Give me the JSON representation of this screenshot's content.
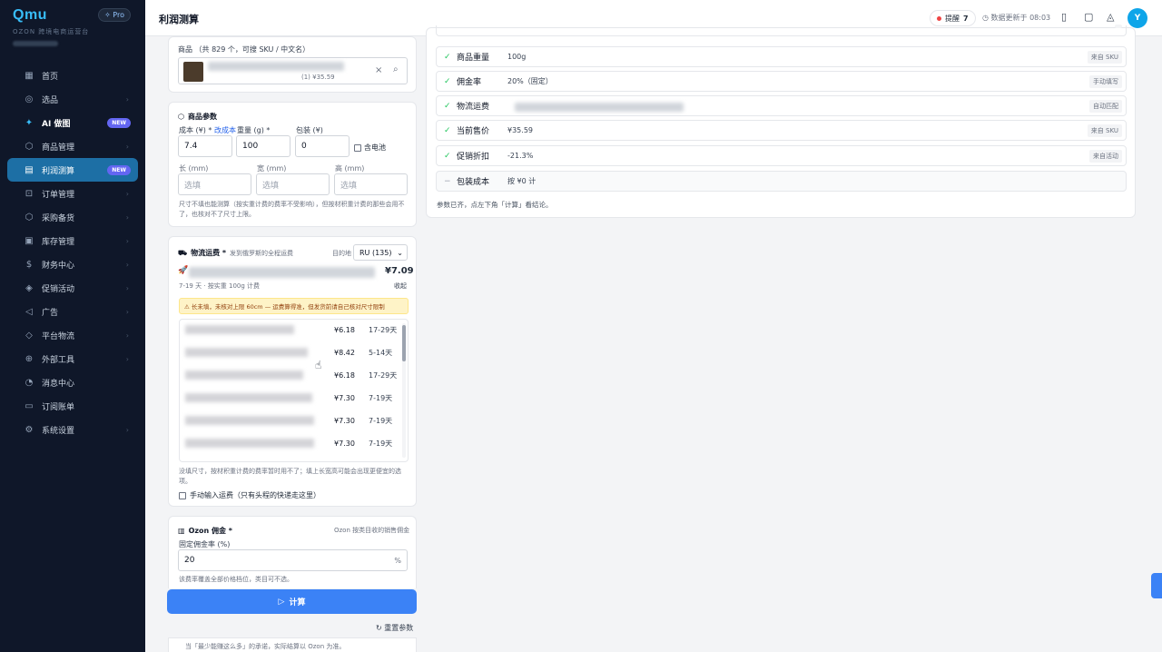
{
  "sidebar": {
    "logo": "Qmu",
    "logo_sub": "OZON 跨境电商运营台",
    "pro": "✧ Pro",
    "new_badge": "NEW",
    "items": [
      {
        "label": "首页",
        "icon": "▦"
      },
      {
        "label": "选品",
        "icon": "◎"
      },
      {
        "label": "AI 做图",
        "icon": "✦"
      },
      {
        "label": "商品管理",
        "icon": "⬡"
      },
      {
        "label": "利润测算",
        "icon": "▤"
      },
      {
        "label": "订单管理",
        "icon": "⊡"
      },
      {
        "label": "采购备货",
        "icon": "⬡"
      },
      {
        "label": "库存管理",
        "icon": "▣"
      },
      {
        "label": "财务中心",
        "icon": "$"
      },
      {
        "label": "促销活动",
        "icon": "◈"
      },
      {
        "label": "广告",
        "icon": "◁"
      },
      {
        "label": "平台物流",
        "icon": "◇"
      },
      {
        "label": "外部工具",
        "icon": "⊕"
      },
      {
        "label": "消息中心",
        "icon": "◔"
      },
      {
        "label": "订阅账单",
        "icon": "▭"
      },
      {
        "label": "系统设置",
        "icon": "⚙"
      }
    ]
  },
  "header": {
    "title": "利润测算",
    "remind_label": "提醒",
    "remind_count": "7",
    "updated": "数据更新于 08:03",
    "avatar": "Y"
  },
  "product": {
    "label": "商品 （共 829 个，可搜 SKU / 中文名）",
    "price_text": "(1) ¥35.59"
  },
  "params": {
    "title": "商品参数",
    "cost_label": "成本 (¥) *",
    "cost_link": "改成本",
    "weight_label": "重量 (g) *",
    "pack_label": "包装 (¥)",
    "cost": "7.4",
    "weight": "100",
    "pack": "0",
    "battery": "含电池",
    "len_label": "长 (mm)",
    "wid_label": "宽 (mm)",
    "hei_label": "高 (mm)",
    "placeholder": "选填",
    "note": "尺寸不填也能测算（按实重计费的费率不受影响），但按材积重计费的那些会用不了，也核对不了尺寸上限。"
  },
  "logistics": {
    "title": "物流运费 *",
    "subtitle": "发到俄罗斯的全程运费",
    "dest_label": "目的地",
    "dest": "RU (135)",
    "selected_price": "¥7.09",
    "selected_meta": "7-19 天 · 按实重 100g 计费",
    "collapse": "收起",
    "warning": "⚠ 长未填，未核对上限 60cm — 运费算得准，但发货前请自己核对尺寸限制",
    "routes": [
      {
        "price": "¥6.18",
        "days": "17-29天"
      },
      {
        "price": "¥8.42",
        "days": "5-14天"
      },
      {
        "price": "¥6.18",
        "days": "17-29天"
      },
      {
        "price": "¥7.30",
        "days": "7-19天"
      },
      {
        "price": "¥7.30",
        "days": "7-19天"
      },
      {
        "price": "¥7.30",
        "days": "7-19天"
      }
    ],
    "note": "没填尺寸，按材积重计费的费率暂时用不了；填上长宽高可能会出现更便宜的选项。",
    "manual": "手动输入运费（只有头程的快递走这里）"
  },
  "commission": {
    "title": "Ozon 佣金 *",
    "hint": "Ozon 按类目收的销售佣金",
    "rate_label": "固定佣金率 (%)",
    "rate": "20",
    "unit": "%",
    "note": "该费率覆盖全部价格档位，类目可不选。"
  },
  "actions": {
    "calc": "计算",
    "reset": "重置参数",
    "bottom_note": "当「最少能赚这么多」的承诺，实际结算以 Ozon 为准。"
  },
  "summary": {
    "rows": [
      {
        "name": "商品重量",
        "value": "100g",
        "tag": "来自 SKU"
      },
      {
        "name": "佣金率",
        "value": "20%（固定）",
        "tag": "手动填写"
      },
      {
        "name": "物流运费",
        "value": "",
        "tag": "自动匹配"
      },
      {
        "name": "当前售价",
        "value": "¥35.59",
        "tag": "来自 SKU"
      },
      {
        "name": "促销折扣",
        "value": "-21.3%",
        "tag": "来自活动"
      },
      {
        "name": "包装成本",
        "value": "按 ¥0 计",
        "tag": ""
      }
    ],
    "footer": "参数已齐，点左下角「计算」看结论。"
  },
  "colors": {
    "sidebar_bg": "#0f1729",
    "active": "#1d6fa5",
    "primary": "#3b82f6",
    "success": "#22c55e"
  }
}
